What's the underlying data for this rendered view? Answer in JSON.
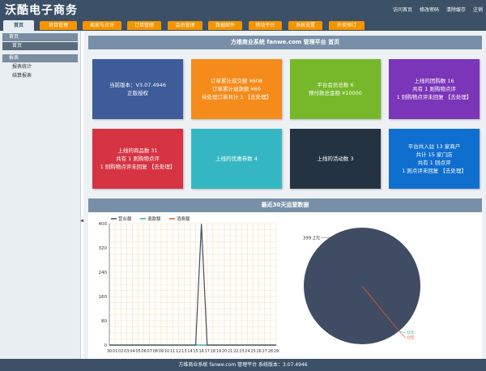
{
  "header": {
    "brand": "沃酷电子商务",
    "links": [
      "访问首页",
      "修改密码",
      "清除缓存",
      "注销"
    ]
  },
  "nav": {
    "tabs": [
      "首页",
      "项目管理",
      "商家与点评",
      "订单管理",
      "会员管理",
      "数据邮件",
      "移动平台",
      "系统设置",
      "外卖预订"
    ],
    "active": "首页"
  },
  "sidebar": {
    "group1": {
      "title": "首页",
      "items": [
        "首页"
      ]
    },
    "group2": {
      "title": "报表",
      "items": [
        "报表统计",
        "结算报表"
      ]
    }
  },
  "main": {
    "title": "方维商业系统 fanwe.com 管理平台 首页",
    "cards": [
      {
        "lines": [
          "当前版本：V3.07.4946",
          "正版授权"
        ],
        "color": "#3e5b9a"
      },
      {
        "lines": [
          "订单累计成交额 ¥608",
          "订单累计退款额 ¥69",
          "待处理订单共计 1 【去处理】"
        ],
        "color": "#f48b1b"
      },
      {
        "lines": [
          "平台会员总数 6",
          "预付款总金额 ¥10000"
        ],
        "color": "#76b82a"
      },
      {
        "lines": [
          "上线的团购数 16",
          "共有 1 则购物点评",
          "1 则购物点评未回复 【去处理】"
        ],
        "color": "#7b35b8"
      },
      {
        "lines": [
          "上线的商品数 31",
          "共有 1 则购物点评",
          "1 则购物点评未回复 【去处理】"
        ],
        "color": "#d63443"
      },
      {
        "lines": [
          "上线的优惠券数 4"
        ],
        "color": "#35b7c3"
      },
      {
        "lines": [
          "上线的活动数 3"
        ],
        "color": "#243342"
      },
      {
        "lines": [
          "平台共入驻 13 家商户",
          "共计 15 家门店",
          "共有 1 则点评",
          "1 则点评未回复 【去处理】"
        ],
        "color": "#0f6fcf"
      }
    ],
    "stats_title": "最近30天运营数据"
  },
  "chart_data": [
    {
      "type": "line",
      "x": [
        "30",
        "01",
        "02",
        "03",
        "04",
        "05",
        "06",
        "07",
        "08",
        "09",
        "10",
        "11",
        "12",
        "13",
        "14",
        "15",
        "16",
        "17",
        "18",
        "19",
        "20",
        "21",
        "22",
        "23",
        "24",
        "25",
        "26",
        "27",
        "28",
        "29"
      ],
      "series": [
        {
          "name": "营业额",
          "color": "#3f4c63",
          "values": [
            0,
            0,
            0,
            0,
            0,
            0,
            0,
            0,
            0,
            0,
            0,
            0,
            0,
            0,
            0,
            0,
            399.2,
            0,
            0,
            0,
            0,
            0,
            0,
            0,
            0,
            0,
            0,
            0,
            0,
            0
          ]
        },
        {
          "name": "退款额",
          "color": "#2bb3a7",
          "values": [
            0,
            0,
            0,
            0,
            0,
            0,
            0,
            0,
            0,
            0,
            0,
            0,
            0,
            0,
            0,
            0,
            0,
            0,
            0,
            0,
            0,
            0,
            0,
            0,
            0,
            0,
            0,
            0,
            0,
            0
          ]
        },
        {
          "name": "消费额",
          "color": "#e8592b",
          "values": [
            0,
            0,
            0,
            0,
            0,
            0,
            0,
            0,
            0,
            0,
            0,
            0,
            0,
            0,
            0,
            0,
            0,
            0,
            0,
            0,
            0,
            0,
            0,
            0,
            0,
            0,
            0,
            0,
            0,
            0
          ]
        }
      ],
      "yticks": [
        "400",
        "320",
        "240",
        "160",
        "80",
        "0"
      ],
      "ylim": [
        0,
        400
      ],
      "legend": "top-left",
      "grid": true
    },
    {
      "type": "pie",
      "slices": [
        {
          "label": "399.2元",
          "value": 399.2,
          "color": "#3f4c63"
        },
        {
          "label": "0元",
          "value": 0,
          "color": "#2bb3a7"
        },
        {
          "label": "0元",
          "value": 0,
          "color": "#e8592b"
        }
      ]
    }
  ],
  "footer": {
    "text": "方维商业系统 fanwe.com 管理平台 系统版本：3.07.4946"
  }
}
